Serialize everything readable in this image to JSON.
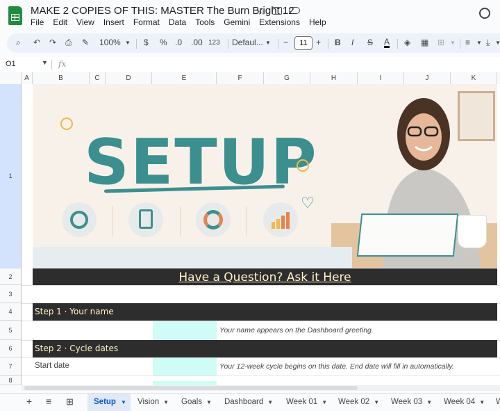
{
  "window": {
    "doc_title": "MAKE 2 COPIES OF THIS: MASTER The Burn Bright 12"
  },
  "menu": [
    "File",
    "Edit",
    "View",
    "Insert",
    "Format",
    "Data",
    "Tools",
    "Gemini",
    "Extensions",
    "Help"
  ],
  "toolbar": {
    "zoom": "100%",
    "currency": "$",
    "percent": "%",
    "dec_decrease": ".0",
    "dec_increase": ".00",
    "number_format": "123",
    "font": "Defaul...",
    "font_size": "11",
    "bold": "B",
    "italic": "I",
    "strike": "S",
    "text_color": "A"
  },
  "formula_bar": {
    "cell_ref": "O1",
    "fx": "fx"
  },
  "columns": [
    "A",
    "B",
    "C",
    "D",
    "E",
    "F",
    "G",
    "H",
    "I",
    "J",
    "K"
  ],
  "rows": [
    "1",
    "2",
    "3",
    "4",
    "5",
    "6",
    "7",
    "8"
  ],
  "banner": {
    "heading": "SETUP"
  },
  "sheet": {
    "question_link": "Have a Question? Ask it Here",
    "step1_label": "Step 1  ·  Your name",
    "step1_hint": "Your name appears on the Dashboard greeting.",
    "step2_label": "Step 2  ·  Cycle dates",
    "start_date_label": "Start date",
    "step2_hint": "Your 12-week cycle begins on this date. End date will fill in automatically."
  },
  "tabs": [
    "Setup",
    "Vision",
    "Goals",
    "Dashboard",
    "Week 01",
    "Week 02",
    "Week 03",
    "Week 04",
    "W"
  ],
  "active_tab": "Setup",
  "colors": {
    "accent_teal": "#3c8f8f",
    "header_bar": "#2d2d2d",
    "input_fill": "#d0fcf7",
    "link_cream": "#fff3c9"
  }
}
